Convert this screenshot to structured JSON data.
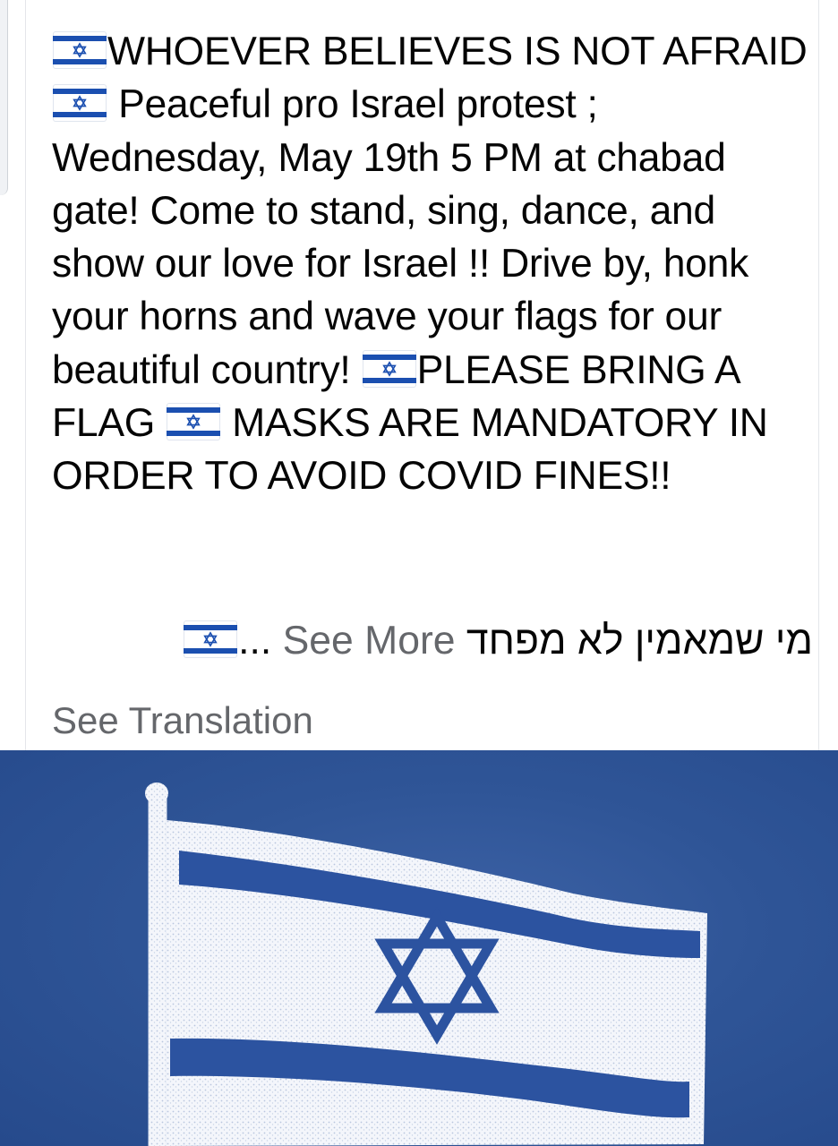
{
  "post": {
    "segments": [
      {
        "type": "flag",
        "icon": "israel-flag-emoji"
      },
      {
        "type": "text",
        "text": "WHOEVER BELIEVES IS NOT AFRAID "
      },
      {
        "type": "flag",
        "icon": "israel-flag-emoji"
      },
      {
        "type": "text",
        "text": " Peaceful pro Israel protest ; Wednesday, May 19th 5 PM at chabad gate! Come to stand, sing, dance, and show our love for Israel !! Drive by, honk your horns and wave your flags for our beautiful country! "
      },
      {
        "type": "flag",
        "icon": "israel-flag-emoji"
      },
      {
        "type": "text",
        "text": "PLEASE BRING A FLAG "
      },
      {
        "type": "flag",
        "icon": "israel-flag-emoji"
      },
      {
        "type": "text",
        "text": " MASKS ARE MANDATORY IN ORDER TO AVOID COVID FINES!!"
      }
    ],
    "hebrew_text": "מי שמאמין לא מפחד",
    "see_more_label": "See More",
    "ellipsis": "...",
    "see_translation_label": "See Translation"
  },
  "photo": {
    "subject": "israel-flag-on-pole",
    "colors": {
      "background": "#2f5597",
      "flag_white": "#f4f6fb",
      "flag_blue": "#2c53a0"
    }
  },
  "colors": {
    "text": "#050505",
    "secondary_text": "#65676b",
    "card_border": "#e4e6ea",
    "flag_emoji_blue": "#1b4fb0"
  }
}
